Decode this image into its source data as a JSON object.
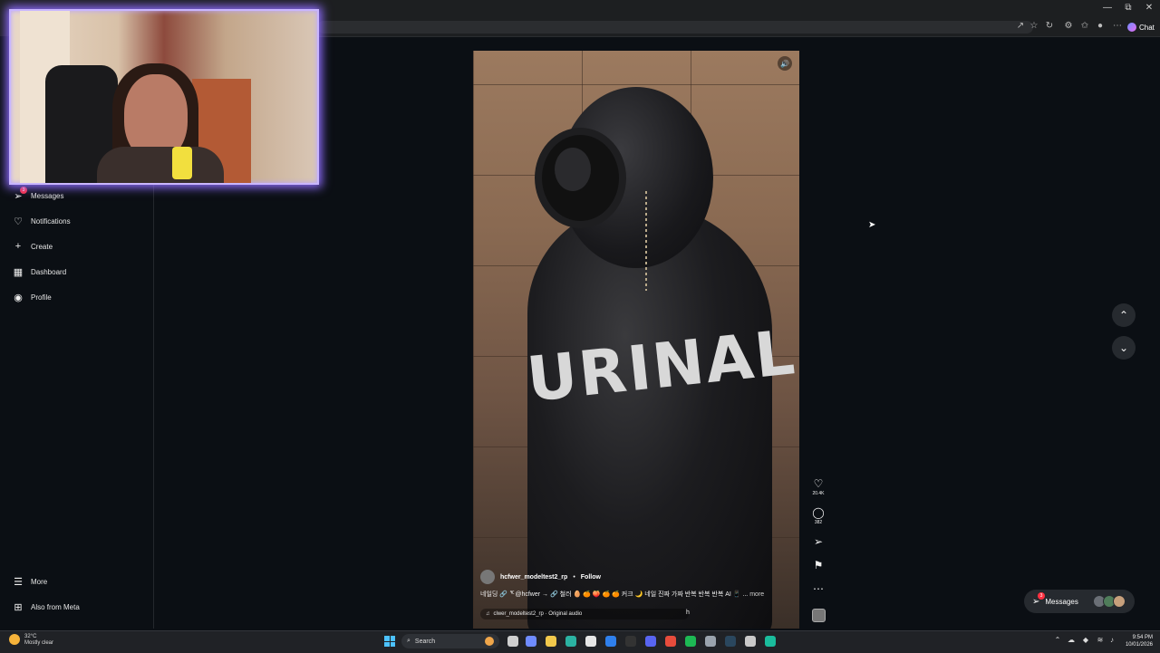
{
  "browser": {
    "window_controls": [
      "—",
      "⧉",
      "✕"
    ],
    "chat_label": "Chat"
  },
  "sidebar": {
    "items": [
      {
        "label": "Messages",
        "badge": "3",
        "icon": "send-icon"
      },
      {
        "label": "Notifications",
        "icon": "heart-icon"
      },
      {
        "label": "Create",
        "icon": "plus-icon"
      },
      {
        "label": "Dashboard",
        "icon": "chart-icon"
      },
      {
        "label": "Profile",
        "icon": "avatar-icon"
      }
    ],
    "bottom": [
      {
        "label": "More",
        "icon": "menu-icon"
      },
      {
        "label": "Also from Meta",
        "icon": "meta-apps-icon"
      }
    ]
  },
  "reel": {
    "overlay_text": "URINAL",
    "author": "hcfwer_modeltest2_rp",
    "separator": "•",
    "follow_label": "Follow",
    "caption": "네일딩 🔗 ᄀᄃ@hcfwer → 🔗 철러 🥚 🍊 🍑 🍊 🍊 커크 🌙 네일 진짜 가짜 반복 반복 반복 AI 📱 ...",
    "more_label": "more",
    "audio": "clwer_modeltest2_rp · Original audio",
    "audio_trailing": "h",
    "likes": "20.4K",
    "comments": "382"
  },
  "messages_pill": {
    "label": "Messages",
    "badge": "3"
  },
  "taskbar": {
    "weather_temp": "32°C",
    "weather_desc": "Mostly clear",
    "search_label": "Search",
    "time": "9:54 PM",
    "date": "10/01/2026"
  },
  "colors": {
    "background": "#0b0f14",
    "accent_badge": "#ff3040",
    "webcam_border": "#c9b6ff"
  }
}
